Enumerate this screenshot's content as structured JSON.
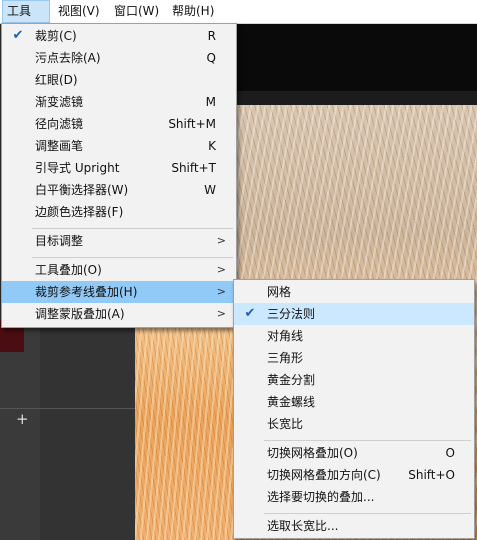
{
  "menubar": {
    "items": [
      {
        "label": "工具(T)"
      },
      {
        "label": "视图(V)"
      },
      {
        "label": "窗口(W)"
      },
      {
        "label": "帮助(H)"
      }
    ]
  },
  "tools_menu": {
    "items": [
      {
        "label": "裁剪(C)",
        "shortcut": "R",
        "checked": true
      },
      {
        "label": "污点去除(A)",
        "shortcut": "Q"
      },
      {
        "label": "红眼(D)",
        "shortcut": ""
      },
      {
        "label": "渐变滤镜",
        "shortcut": "M"
      },
      {
        "label": "径向滤镜",
        "shortcut": "Shift+M"
      },
      {
        "label": "调整画笔",
        "shortcut": "K"
      },
      {
        "label": "引导式 Upright",
        "shortcut": "Shift+T"
      },
      {
        "label": "白平衡选择器(W)",
        "shortcut": "W"
      },
      {
        "label": "边颜色选择器(F)",
        "shortcut": ""
      },
      {
        "label": "目标调整",
        "submenu_arrow": ">"
      },
      {
        "label": "工具叠加(O)",
        "submenu_arrow": ">"
      },
      {
        "label": "裁剪参考线叠加(H)",
        "submenu_arrow": ">",
        "highlighted": true
      },
      {
        "label": "调整蒙版叠加(A)",
        "submenu_arrow": ">"
      }
    ]
  },
  "crop_overlay_submenu": {
    "items": [
      {
        "label": "网格"
      },
      {
        "label": "三分法则",
        "checked": true
      },
      {
        "label": "对角线"
      },
      {
        "label": "三角形"
      },
      {
        "label": "黄金分割"
      },
      {
        "label": "黄金螺线"
      },
      {
        "label": "长宽比"
      },
      {
        "label": "切换网格叠加(O)",
        "shortcut": "O"
      },
      {
        "label": "切换网格叠加方向(C)",
        "shortcut": "Shift+O"
      },
      {
        "label": "选择要切换的叠加..."
      },
      {
        "label": "选取长宽比..."
      }
    ]
  },
  "icons": {
    "check": "✔",
    "submenu_arrow": ">",
    "add": "+"
  }
}
